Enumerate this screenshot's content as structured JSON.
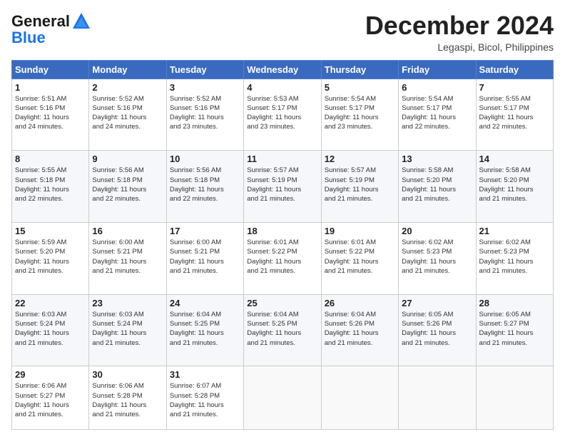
{
  "header": {
    "logo_general": "General",
    "logo_blue": "Blue",
    "month_title": "December 2024",
    "location": "Legaspi, Bicol, Philippines"
  },
  "columns": [
    "Sunday",
    "Monday",
    "Tuesday",
    "Wednesday",
    "Thursday",
    "Friday",
    "Saturday"
  ],
  "weeks": [
    [
      {
        "day": "1",
        "info": "Sunrise: 5:51 AM\nSunset: 5:16 PM\nDaylight: 11 hours\nand 24 minutes."
      },
      {
        "day": "2",
        "info": "Sunrise: 5:52 AM\nSunset: 5:16 PM\nDaylight: 11 hours\nand 24 minutes."
      },
      {
        "day": "3",
        "info": "Sunrise: 5:52 AM\nSunset: 5:16 PM\nDaylight: 11 hours\nand 23 minutes."
      },
      {
        "day": "4",
        "info": "Sunrise: 5:53 AM\nSunset: 5:17 PM\nDaylight: 11 hours\nand 23 minutes."
      },
      {
        "day": "5",
        "info": "Sunrise: 5:54 AM\nSunset: 5:17 PM\nDaylight: 11 hours\nand 23 minutes."
      },
      {
        "day": "6",
        "info": "Sunrise: 5:54 AM\nSunset: 5:17 PM\nDaylight: 11 hours\nand 22 minutes."
      },
      {
        "day": "7",
        "info": "Sunrise: 5:55 AM\nSunset: 5:17 PM\nDaylight: 11 hours\nand 22 minutes."
      }
    ],
    [
      {
        "day": "8",
        "info": "Sunrise: 5:55 AM\nSunset: 5:18 PM\nDaylight: 11 hours\nand 22 minutes."
      },
      {
        "day": "9",
        "info": "Sunrise: 5:56 AM\nSunset: 5:18 PM\nDaylight: 11 hours\nand 22 minutes."
      },
      {
        "day": "10",
        "info": "Sunrise: 5:56 AM\nSunset: 5:18 PM\nDaylight: 11 hours\nand 22 minutes."
      },
      {
        "day": "11",
        "info": "Sunrise: 5:57 AM\nSunset: 5:19 PM\nDaylight: 11 hours\nand 21 minutes."
      },
      {
        "day": "12",
        "info": "Sunrise: 5:57 AM\nSunset: 5:19 PM\nDaylight: 11 hours\nand 21 minutes."
      },
      {
        "day": "13",
        "info": "Sunrise: 5:58 AM\nSunset: 5:20 PM\nDaylight: 11 hours\nand 21 minutes."
      },
      {
        "day": "14",
        "info": "Sunrise: 5:58 AM\nSunset: 5:20 PM\nDaylight: 11 hours\nand 21 minutes."
      }
    ],
    [
      {
        "day": "15",
        "info": "Sunrise: 5:59 AM\nSunset: 5:20 PM\nDaylight: 11 hours\nand 21 minutes."
      },
      {
        "day": "16",
        "info": "Sunrise: 6:00 AM\nSunset: 5:21 PM\nDaylight: 11 hours\nand 21 minutes."
      },
      {
        "day": "17",
        "info": "Sunrise: 6:00 AM\nSunset: 5:21 PM\nDaylight: 11 hours\nand 21 minutes."
      },
      {
        "day": "18",
        "info": "Sunrise: 6:01 AM\nSunset: 5:22 PM\nDaylight: 11 hours\nand 21 minutes."
      },
      {
        "day": "19",
        "info": "Sunrise: 6:01 AM\nSunset: 5:22 PM\nDaylight: 11 hours\nand 21 minutes."
      },
      {
        "day": "20",
        "info": "Sunrise: 6:02 AM\nSunset: 5:23 PM\nDaylight: 11 hours\nand 21 minutes."
      },
      {
        "day": "21",
        "info": "Sunrise: 6:02 AM\nSunset: 5:23 PM\nDaylight: 11 hours\nand 21 minutes."
      }
    ],
    [
      {
        "day": "22",
        "info": "Sunrise: 6:03 AM\nSunset: 5:24 PM\nDaylight: 11 hours\nand 21 minutes."
      },
      {
        "day": "23",
        "info": "Sunrise: 6:03 AM\nSunset: 5:24 PM\nDaylight: 11 hours\nand 21 minutes."
      },
      {
        "day": "24",
        "info": "Sunrise: 6:04 AM\nSunset: 5:25 PM\nDaylight: 11 hours\nand 21 minutes."
      },
      {
        "day": "25",
        "info": "Sunrise: 6:04 AM\nSunset: 5:25 PM\nDaylight: 11 hours\nand 21 minutes."
      },
      {
        "day": "26",
        "info": "Sunrise: 6:04 AM\nSunset: 5:26 PM\nDaylight: 11 hours\nand 21 minutes."
      },
      {
        "day": "27",
        "info": "Sunrise: 6:05 AM\nSunset: 5:26 PM\nDaylight: 11 hours\nand 21 minutes."
      },
      {
        "day": "28",
        "info": "Sunrise: 6:05 AM\nSunset: 5:27 PM\nDaylight: 11 hours\nand 21 minutes."
      }
    ],
    [
      {
        "day": "29",
        "info": "Sunrise: 6:06 AM\nSunset: 5:27 PM\nDaylight: 11 hours\nand 21 minutes."
      },
      {
        "day": "30",
        "info": "Sunrise: 6:06 AM\nSunset: 5:28 PM\nDaylight: 11 hours\nand 21 minutes."
      },
      {
        "day": "31",
        "info": "Sunrise: 6:07 AM\nSunset: 5:28 PM\nDaylight: 11 hours\nand 21 minutes."
      },
      {
        "day": "",
        "info": ""
      },
      {
        "day": "",
        "info": ""
      },
      {
        "day": "",
        "info": ""
      },
      {
        "day": "",
        "info": ""
      }
    ]
  ]
}
